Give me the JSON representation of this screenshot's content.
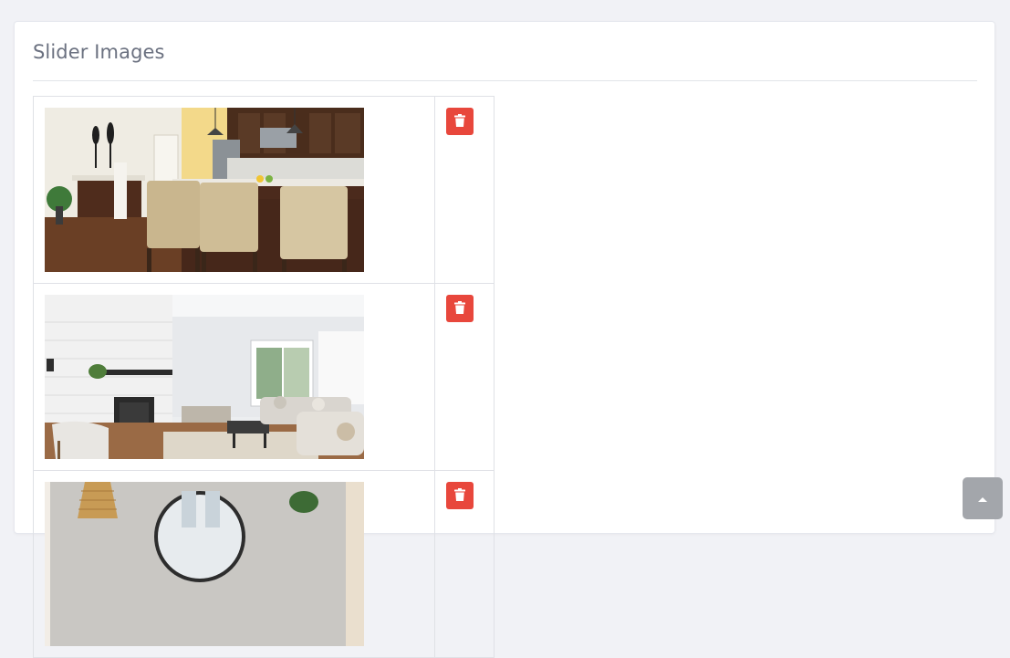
{
  "card": {
    "title": "Slider Images"
  },
  "slider_images": [
    {
      "alt": "kitchen-with-island-and-bar-stools"
    },
    {
      "alt": "living-room-with-white-brick-fireplace"
    },
    {
      "alt": "room-with-round-mirror-and-rattan-lamp"
    }
  ],
  "icons": {
    "delete": "trash-icon",
    "scroll_top": "caret-up-icon"
  },
  "colors": {
    "delete_button": "#e8473c",
    "scroll_top_button": "#a3a6ab",
    "title_text": "#6b7180"
  }
}
